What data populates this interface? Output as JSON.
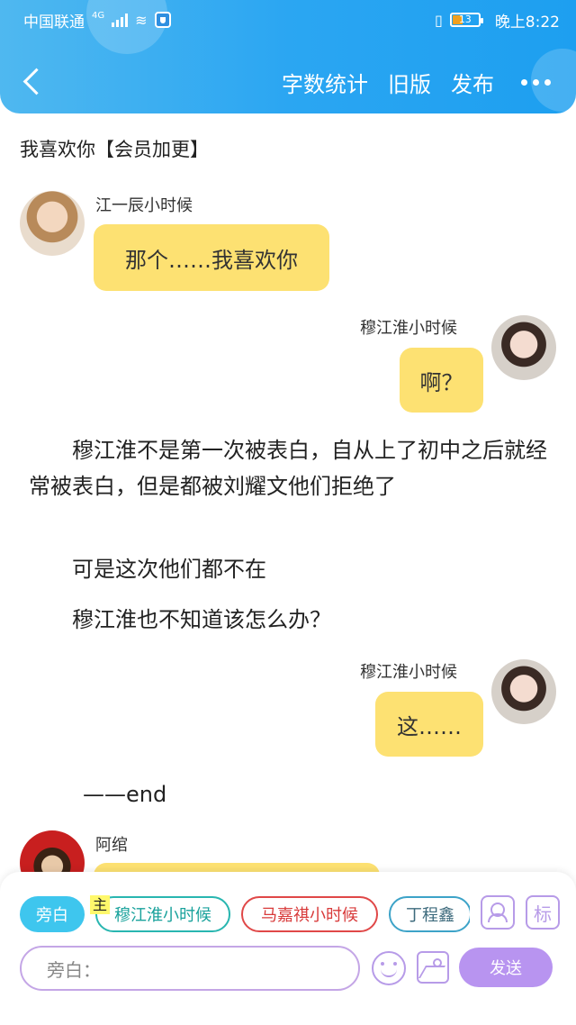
{
  "status_bar": {
    "carrier": "中国联通",
    "network": "4G",
    "battery_level": "13",
    "time": "晚上8:22"
  },
  "toolbar": {
    "word_count": "字数统计",
    "old_version": "旧版",
    "publish": "发布"
  },
  "story_title": "我喜欢你【会员加更】",
  "messages": [
    {
      "name": "江一辰小时候",
      "text": "那个……我喜欢你"
    },
    {
      "name": "穆江淮小时候",
      "text": "啊？"
    },
    {
      "name": "穆江淮小时候",
      "text": "这……"
    },
    {
      "name": "阿绾",
      "text": ""
    }
  ],
  "narration": [
    "　　穆江淮不是第一次被表白，自从上了初中之后就经常被表白，但是都被刘耀文他们拒绝了",
    "　　可是这次他们都不在",
    "　　穆江淮也不知道该怎么办？",
    "——end"
  ],
  "bottom_panel": {
    "chips": {
      "narrator": "旁白",
      "main_tag": "主",
      "c1": "穆江淮小时候",
      "c2": "马嘉祺小时候",
      "c3": "丁程鑫"
    },
    "tag_button": "标",
    "input_placeholder": "旁白：",
    "send": "发送"
  },
  "colors": {
    "header_blue": "#2ba6f2",
    "bubble_yellow": "#fde172",
    "send_purple": "#b894f0",
    "narrator_chip": "#3ec6ee"
  }
}
